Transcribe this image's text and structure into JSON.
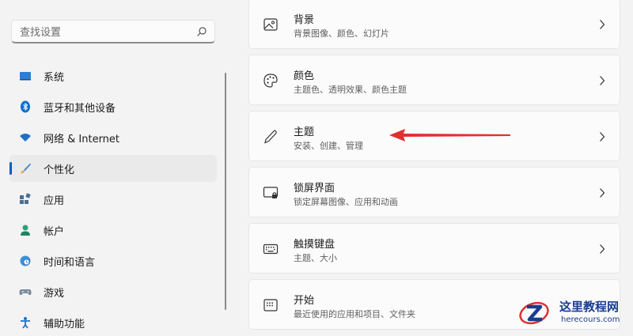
{
  "search": {
    "placeholder": "查找设置"
  },
  "sidebar": {
    "items": [
      {
        "label": "系统",
        "icon": "display-icon"
      },
      {
        "label": "蓝牙和其他设备",
        "icon": "bluetooth-icon"
      },
      {
        "label": "网络 & Internet",
        "icon": "wifi-icon"
      },
      {
        "label": "个性化",
        "icon": "brush-icon",
        "active": true
      },
      {
        "label": "应用",
        "icon": "apps-icon"
      },
      {
        "label": "帐户",
        "icon": "person-icon"
      },
      {
        "label": "时间和语言",
        "icon": "globe-clock-icon"
      },
      {
        "label": "游戏",
        "icon": "gamepad-icon"
      },
      {
        "label": "辅助功能",
        "icon": "accessibility-icon"
      }
    ]
  },
  "cards": [
    {
      "title": "背景",
      "subtitle": "背景图像、颜色、幻灯片",
      "icon": "image-icon"
    },
    {
      "title": "颜色",
      "subtitle": "主题色、透明效果、颜色主题",
      "icon": "palette-icon"
    },
    {
      "title": "主题",
      "subtitle": "安装、创建、管理",
      "icon": "pen-icon"
    },
    {
      "title": "锁屏界面",
      "subtitle": "锁定屏幕图像、应用和动画",
      "icon": "lock-screen-icon"
    },
    {
      "title": "触摸键盘",
      "subtitle": "主题、大小",
      "icon": "keyboard-icon"
    },
    {
      "title": "开始",
      "subtitle": "最近使用的应用和项目、文件夹",
      "icon": "start-icon"
    }
  ],
  "watermark": {
    "name": "这里教程网",
    "url": "herecours.com"
  },
  "colors": {
    "accent": "#005fb8",
    "arrow": "#e03030",
    "watermark": "#1a3d8f"
  }
}
